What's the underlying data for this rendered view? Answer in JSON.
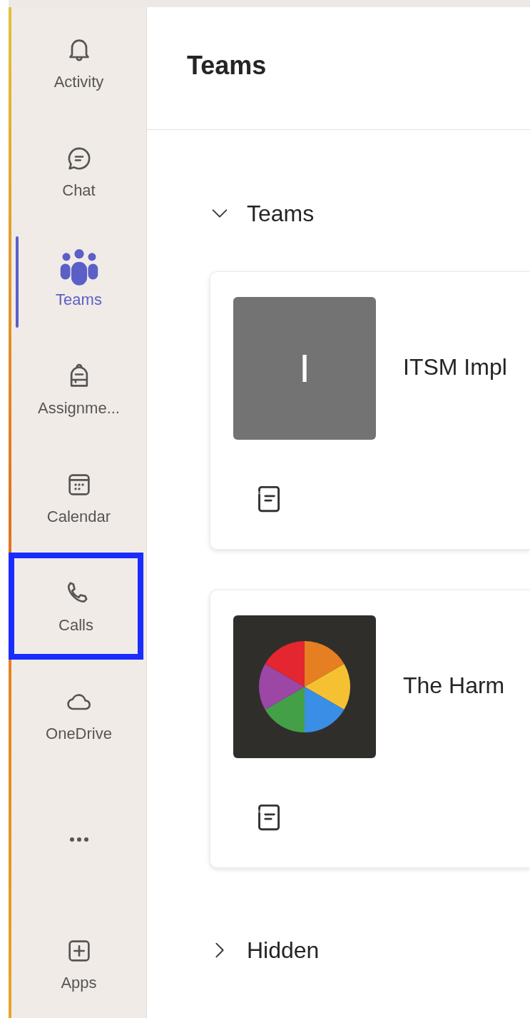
{
  "nav": {
    "items": [
      {
        "kind": "bell",
        "label": "Activity",
        "selected": false,
        "highlighted": false
      },
      {
        "kind": "chat",
        "label": "Chat",
        "selected": false,
        "highlighted": false
      },
      {
        "kind": "teams",
        "label": "Teams",
        "selected": true,
        "highlighted": false
      },
      {
        "kind": "backpack",
        "label": "Assignme...",
        "selected": false,
        "highlighted": false
      },
      {
        "kind": "calendar",
        "label": "Calendar",
        "selected": false,
        "highlighted": false
      },
      {
        "kind": "phone",
        "label": "Calls",
        "selected": false,
        "highlighted": true
      },
      {
        "kind": "cloud",
        "label": "OneDrive",
        "selected": false,
        "highlighted": false
      },
      {
        "kind": "more",
        "selected": false,
        "highlighted": false
      },
      {
        "kind": "apps",
        "label": "Apps",
        "selected": false,
        "highlighted": false
      }
    ]
  },
  "header": {
    "title": "Teams"
  },
  "sections": [
    {
      "label": "Teams",
      "expanded": true,
      "teams": [
        {
          "name": "ITSM Impl",
          "avatar": {
            "kind": "initial",
            "text": "I"
          }
        },
        {
          "name": "The Harm",
          "avatar": {
            "kind": "pie"
          }
        }
      ]
    },
    {
      "label": "Hidden",
      "expanded": false
    }
  ]
}
